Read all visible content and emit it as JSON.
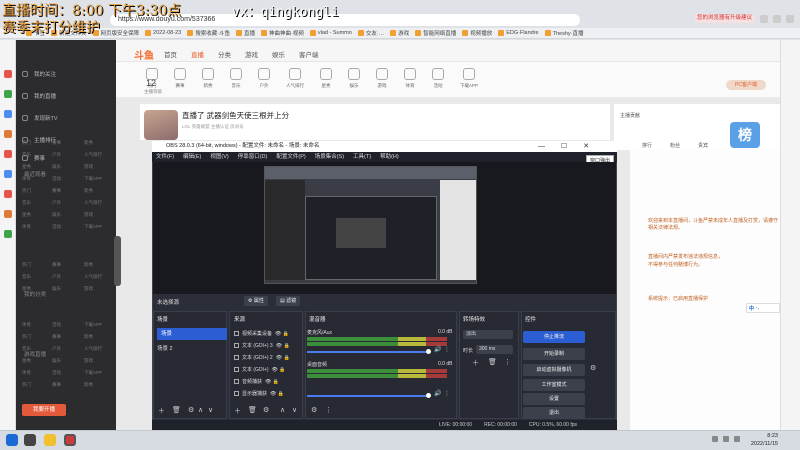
{
  "overlay": {
    "line1": "直播时间：8:00 下午3:30点",
    "line2": "赛季末打分维护",
    "vx": "vx：qingkongli"
  },
  "browser": {
    "url": "https://www.douyu.com/537366",
    "bookmarks": [
      "书签",
      "新建文件夹",
      "网页版安全保障",
      "2022-08-23",
      "搜索收藏·斗鱼",
      "直播",
      "神曲神曲·视频",
      "vlad - Summo",
      "交友·…",
      "游戏",
      "智能网络直播",
      "视频播放",
      "EDG·Flandre",
      "Theshy·直播"
    ],
    "alert_text": "您的浏览器有升级建议",
    "accent": "#f56a2f"
  },
  "douyu": {
    "logo": "斗鱼",
    "nav_tabs": [
      "首页",
      "直播",
      "分类",
      "游戏",
      "娱乐",
      "客户端"
    ],
    "sidebar": {
      "items": [
        "我的关注",
        "我的直播",
        "发现新TV",
        "主播排行",
        "赛事"
      ],
      "section1": "最近观看",
      "section2": "我的分类",
      "section3": "游戏直播",
      "go_live": "我要开播"
    },
    "category_icons": [
      "热门",
      "赛事",
      "新秀",
      "音乐",
      "户外",
      "人气排行",
      "星秀",
      "娱乐",
      "游戏",
      "体育",
      "活动",
      "下载APP"
    ],
    "fans_count": "12",
    "fans_label": "主播等级",
    "room_title": "直播了 武器剑鱼天使三根并上分",
    "room_meta": "LOL   英雄联盟   主播认证   房间号",
    "pc_button": "PC客户端",
    "right_panel": {
      "row1": "主播贡献",
      "tabs": [
        "排行",
        "粉丝",
        "贵宾"
      ],
      "rank_badge": "榜"
    },
    "chat": [
      "欢迎来到本直播间，斗鱼严禁未成年人直播及打赏，请遵守相关法律法规。",
      "直播间内严禁发布违法违规信息，",
      "不得参与任何赌博行为。",
      "系统提示：已启用直播保护"
    ],
    "ime": {
      "label": "中",
      "icons": "·,"
    }
  },
  "obs": {
    "title": "OBS 28.0.3 (64-bit, windows) - 配置文件: 未命名 - 场景: 未命名",
    "window_buttons": [
      "—",
      "☐",
      "✕"
    ],
    "menu": [
      "文件(F)",
      "编辑(E)",
      "视图(V)",
      "停靠窗口(D)",
      "配置文件(P)",
      "场景集合(S)",
      "工具(T)",
      "帮助(H)"
    ],
    "preview_popup": "窗口弹出",
    "no_source": "未选择源",
    "props_button": "属性",
    "filters_button": "滤镜",
    "docks": {
      "scenes": "场景",
      "sources": "来源",
      "mixer": "混音器",
      "transitions": "转场特效",
      "controls": "控件"
    },
    "scenes": [
      "场景",
      "场景 2"
    ],
    "sources": [
      "视频采集设备",
      "文本 (GDI+) 3",
      "文本 (GDI+) 2",
      "文本 (GDI+)",
      "音频捕获",
      "显示器捕获"
    ],
    "mixer": [
      {
        "name": "麦克风/Aux",
        "db": "0.0 dB"
      },
      {
        "name": "桌面音频",
        "db": "0.0 dB"
      }
    ],
    "transition": {
      "type": "淡出",
      "duration_label": "时长",
      "duration": "300 ms"
    },
    "controls": [
      "停止推流",
      "开始录制",
      "启动虚拟摄像机",
      "工作室模式",
      "设置",
      "退出"
    ],
    "status": {
      "live": "LIVE: 00:00:00",
      "rec": "REC: 00:00:00",
      "cpu": "CPU: 0.5%, 60.00 fps"
    }
  },
  "taskbar": {
    "time": "8:23",
    "date": "2022/11/15"
  }
}
